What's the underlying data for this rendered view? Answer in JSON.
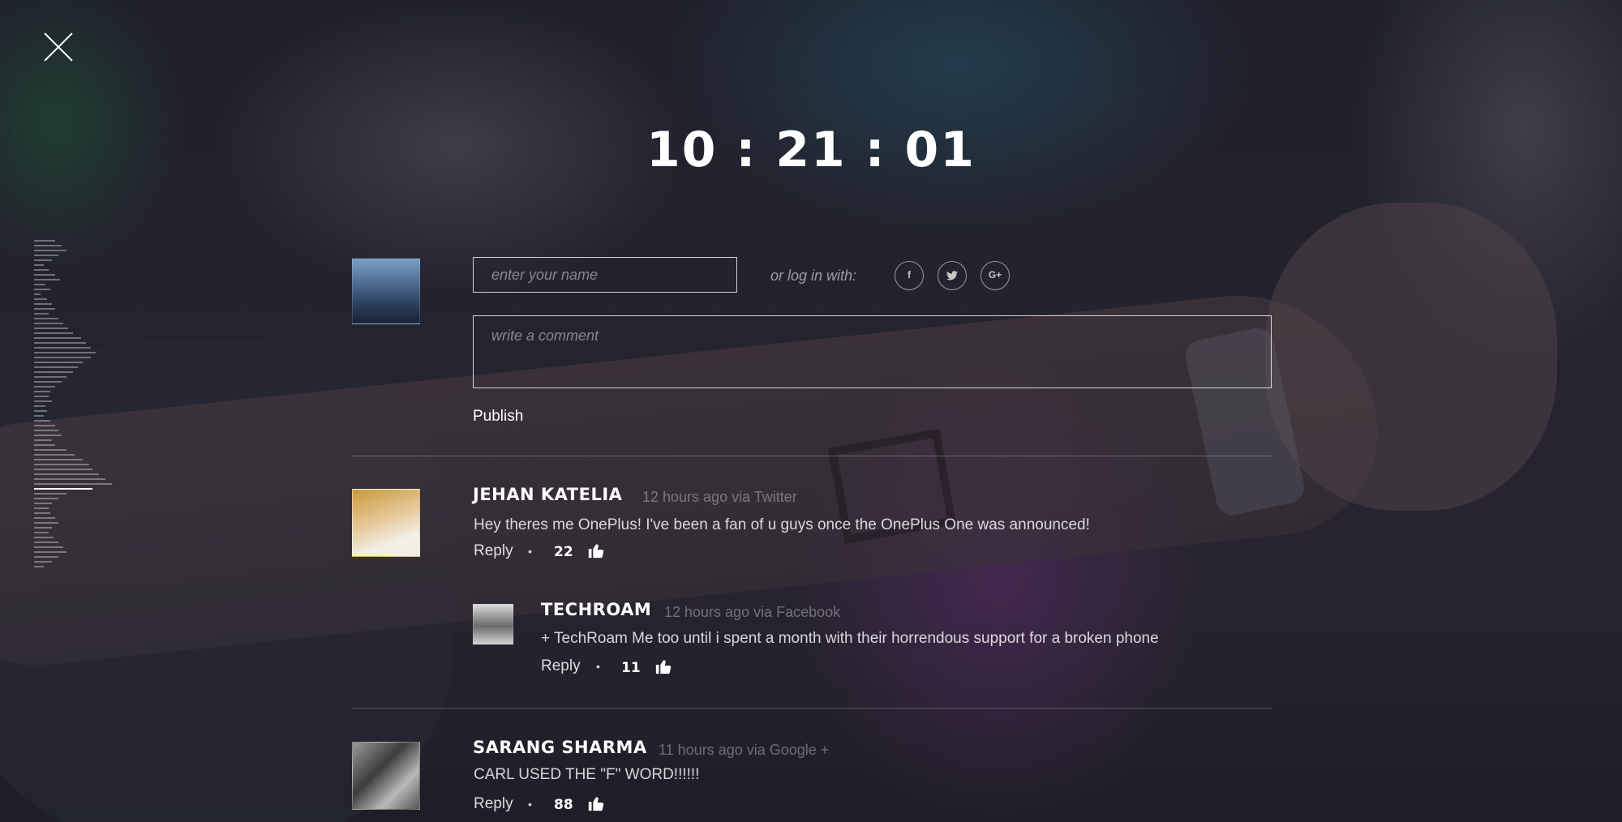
{
  "overlay": {
    "timer": "10 : 21 : 01",
    "close_icon": "close-icon"
  },
  "composer": {
    "name_placeholder": "enter your name",
    "login_label": "or log in with:",
    "social_icons": [
      "facebook-icon",
      "twitter-icon",
      "google-plus-icon"
    ],
    "social_labels": [
      "f",
      "t",
      "G+"
    ],
    "comment_placeholder": "write a comment",
    "publish_label": "Publish"
  },
  "comments": [
    {
      "author": "JEHAN KATELIA",
      "meta": "12 hours ago via Twitter",
      "text": "Hey theres me OnePlus! I've been a fan of u guys once the OnePlus One was announced!",
      "reply_label": "Reply",
      "separator": "•",
      "likes": "22",
      "like_icon": "thumbs-up-icon"
    },
    {
      "author": "TECHROAM",
      "meta": "12 hours ago via Facebook",
      "text": "+ TechRoam Me too until i spent a month with their horrendous support for a broken phone",
      "reply_label": "Reply",
      "separator": "•",
      "likes": "11",
      "like_icon": "thumbs-up-icon"
    },
    {
      "author": "SARANG SHARMA",
      "meta": "11 hours ago via Google +",
      "text": "CARL USED THE \"F\" WORD!!!!!!",
      "reply_label": "Reply",
      "separator": "•",
      "likes": "88",
      "like_icon": "thumbs-up-icon"
    }
  ],
  "colors": {
    "text": "#ffffff",
    "muted": "#8a8a96",
    "overlay": "#1c1c24"
  }
}
